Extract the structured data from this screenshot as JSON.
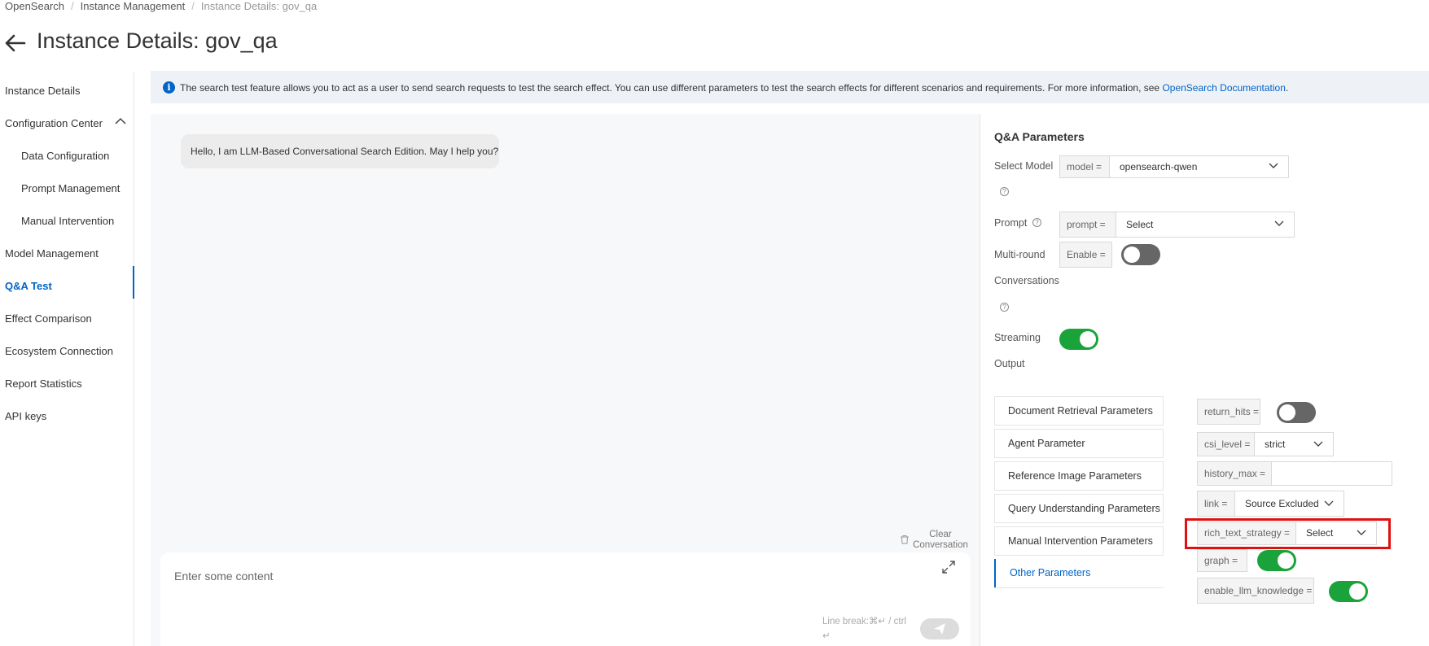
{
  "breadcrumb": [
    "OpenSearch",
    "Instance Management",
    "Instance Details: gov_qa"
  ],
  "header": {
    "title": "Instance Details: gov_qa"
  },
  "sidebar": {
    "items": [
      {
        "label": "Instance Details"
      },
      {
        "label": "Configuration Center"
      },
      {
        "label": "Data Configuration"
      },
      {
        "label": "Prompt Management"
      },
      {
        "label": "Manual Intervention"
      },
      {
        "label": "Model Management"
      },
      {
        "label": "Q&A Test"
      },
      {
        "label": "Effect Comparison"
      },
      {
        "label": "Ecosystem Connection"
      },
      {
        "label": "Report Statistics"
      },
      {
        "label": "API keys"
      }
    ],
    "active": "Q&A Test"
  },
  "banner": {
    "text": "The search test feature allows you to act as a user to send search requests to test the search effect. You can use different parameters to test the search effects for different scenarios and requirements. For more information, see ",
    "link": "OpenSearch Documentation",
    "end": "."
  },
  "chat": {
    "greeting": "Hello, I am LLM-Based Conversational Search Edition. May I help you?",
    "clear_label": "Clear Conversation",
    "input_placeholder": "Enter some content",
    "hint_line1": "Line break:⌘↵ / ctrl",
    "hint_line2": "↵"
  },
  "params": {
    "title": "Q&A Parameters",
    "select_model_label": "Select Model",
    "model_prefix": "model =",
    "model_value": "opensearch-qwen",
    "prompt_label": "Prompt",
    "prompt_prefix": "prompt =",
    "prompt_value": "Select",
    "multiround_label_1": "Multi-round",
    "multiround_label_2": "Conversations",
    "enable_prefix": "Enable =",
    "multiround_on": false,
    "streaming_label_1": "Streaming",
    "streaming_label_2": "Output",
    "streaming_on": true
  },
  "tabs": [
    {
      "label": "Document Retrieval Parameters"
    },
    {
      "label": "Agent Parameter"
    },
    {
      "label": "Reference Image Parameters"
    },
    {
      "label": "Query Understanding Parameters"
    },
    {
      "label": "Manual Intervention Parameters"
    },
    {
      "label": "Other Parameters"
    }
  ],
  "other_params": {
    "return_hits_prefix": "return_hits =",
    "return_hits_on": false,
    "csi_level_prefix": "csi_level =",
    "csi_level_value": "strict",
    "history_max_prefix": "history_max =",
    "history_max_value": "",
    "link_prefix": "link =",
    "link_value": "Source Excluded",
    "rich_text_prefix": "rich_text_strategy =",
    "rich_text_value": "Select",
    "graph_prefix": "graph =",
    "graph_on": true,
    "llm_knowledge_prefix": "enable_llm_knowledge =",
    "llm_knowledge_on": true
  },
  "colors": {
    "accent": "#0064c8",
    "toggle_on": "#1aa33a",
    "toggle_off": "#666666",
    "highlight": "#e01010"
  }
}
